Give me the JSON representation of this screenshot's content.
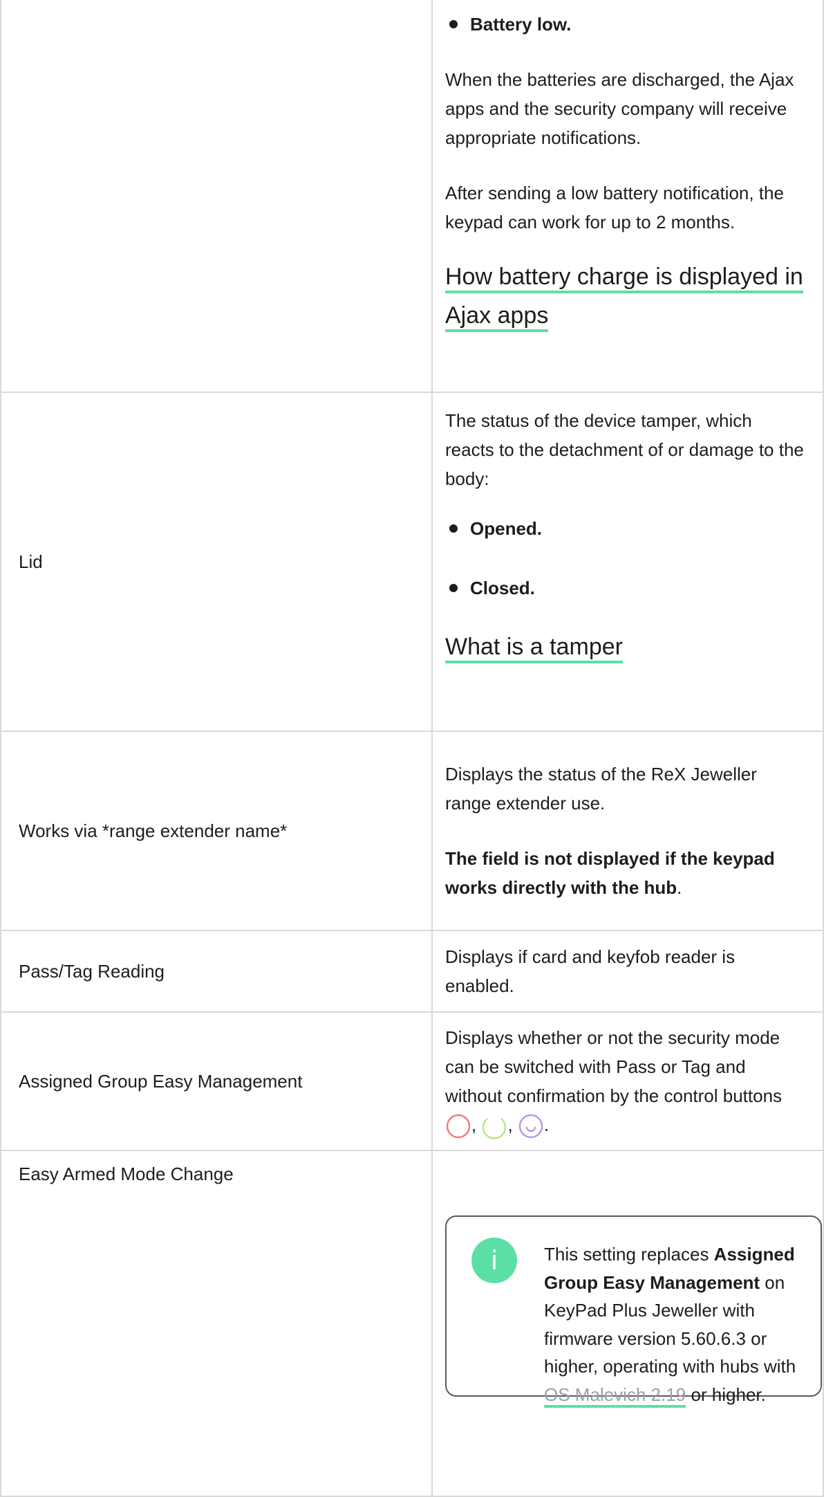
{
  "battery_row": {
    "bullet_low": "Battery low.",
    "para1": "When the batteries are discharged, the Ajax apps and the security company will receive appropriate notifications.",
    "para2": "After sending a low battery notification, the keypad can work for up to 2 months.",
    "link": "How battery charge is displayed in Ajax apps"
  },
  "lid_row": {
    "label": "Lid",
    "desc": "The status of the device tamper, which reacts to the detachment of or damage to the body:",
    "bullet_opened": "Opened.",
    "bullet_closed": "Closed.",
    "link": "What is a tamper"
  },
  "rex_row": {
    "label": "Works via *range extender name*",
    "desc": "Displays the status of the ReX Jeweller range extender use.",
    "note_bold": "The field is not displayed if the keypad works directly with the hub",
    "note_end": "."
  },
  "pass_row": {
    "label": "Pass/Tag Reading",
    "desc": "Displays if card and keyfob reader is enabled."
  },
  "group_row": {
    "label": "Assigned Group Easy Management",
    "desc": "Displays whether or not the security mode can be switched with Pass or Tag and without confirmation by the control buttons",
    "sep1": ",",
    "sep2": ",",
    "end": ".",
    "icons": [
      {
        "name": "disarm-button-icon",
        "color": "#f27a6b"
      },
      {
        "name": "night-mode-button-icon",
        "color": "#b4e97b"
      },
      {
        "name": "arm-button-icon",
        "color": "#b694f2"
      }
    ]
  },
  "easy_row": {
    "label": "Easy Armed Mode Change",
    "info_glyph": "i",
    "note_1": "This setting replaces ",
    "note_bold": "Assigned Group Easy Management",
    "note_2": " on KeyPad Plus Jeweller with firmware version 5.60.6.3 or higher, operating with hubs with ",
    "note_link": "OS Malevich 2.19",
    "note_3": " or higher."
  },
  "colors": {
    "accent": "#5cdfa4",
    "border": "#d9d9d9",
    "text": "#1d1d1d"
  }
}
